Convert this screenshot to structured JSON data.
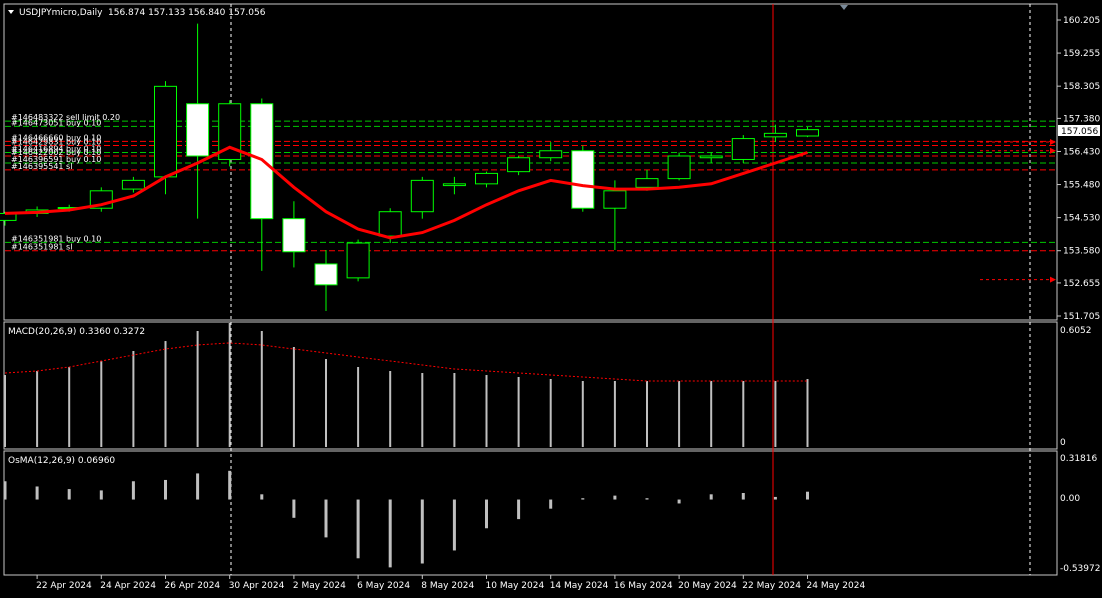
{
  "title": "USDJPYmicro,Daily",
  "ohlc_text": "156.874 157.133 156.840 157.056",
  "colors": {
    "background": "#000000",
    "bull_candle": "#00ff00",
    "bear_candle_body": "#ffffff",
    "ma_line": "#ff0000",
    "order_buy": "#00c800",
    "order_sl": "#ff0000",
    "grid_text": "#ffffff",
    "current_price_box": "#ffffff"
  },
  "main_panel": {
    "price_ticks": [
      "160.205",
      "159.255",
      "158.305",
      "157.380",
      "156.430",
      "155.480",
      "154.530",
      "153.580",
      "152.655",
      "151.705"
    ],
    "price_values": [
      160.205,
      159.255,
      158.305,
      157.38,
      156.43,
      155.48,
      154.53,
      153.58,
      152.655,
      151.705
    ],
    "current_price": "157.056",
    "current_price_value": 157.056,
    "order_labels": [
      {
        "text": "#146483322 sell limit 0.20",
        "price": 157.3,
        "kind": "buy"
      },
      {
        "text": "#146473051 buy 0.10",
        "price": 157.15,
        "kind": "buy"
      },
      {
        "text": "#146466660 buy 0.10",
        "price": 156.72,
        "kind": "sl"
      },
      {
        "text": "#146429831 buy 0.10",
        "price": 156.6,
        "kind": "sl"
      },
      {
        "text": "#146416894 buy 0.10",
        "price": 156.4,
        "kind": "buy"
      },
      {
        "text": "#146422002 buy 0.10",
        "price": 156.3,
        "kind": "sl"
      },
      {
        "text": "#146396591 buy 0.10",
        "price": 156.1,
        "kind": "buy"
      },
      {
        "text": "#146395541 sl",
        "price": 155.9,
        "kind": "sl"
      },
      {
        "text": "#146351981 buy 0.10",
        "price": 153.82,
        "kind": "buy"
      },
      {
        "text": "#146351981 sl",
        "price": 153.58,
        "kind": "sl"
      }
    ]
  },
  "macd_panel": {
    "label": "MACD(20,26,9) 0.3360 0.3272",
    "top_tick": "0.6052",
    "bottom_tick": "0"
  },
  "osma_panel": {
    "label": "OsMA(12,26,9) 0.06960",
    "ticks": [
      "0.31816",
      "0.00",
      "-0.53972"
    ]
  },
  "x_labels": [
    "22 Apr 2024",
    "24 Apr 2024",
    "26 Apr 2024",
    "30 Apr 2024",
    "2 May 2024",
    "6 May 2024",
    "8 May 2024",
    "10 May 2024",
    "14 May 2024",
    "16 May 2024",
    "20 May 2024",
    "22 May 2024",
    "24 May 2024"
  ],
  "chart_data": {
    "type": "candlestick",
    "symbol": "USDJPYmicro",
    "timeframe": "Daily",
    "ylim": [
      151.705,
      160.205
    ],
    "candles": [
      {
        "date": "19 Apr 2024",
        "o": 154.45,
        "h": 154.7,
        "l": 154.3,
        "c": 154.65
      },
      {
        "date": "22 Apr 2024",
        "o": 154.65,
        "h": 154.85,
        "l": 154.55,
        "c": 154.75
      },
      {
        "date": "23 Apr 2024",
        "o": 154.8,
        "h": 154.9,
        "l": 154.7,
        "c": 154.82
      },
      {
        "date": "24 Apr 2024",
        "o": 154.8,
        "h": 155.4,
        "l": 154.7,
        "c": 155.3
      },
      {
        "date": "25 Apr 2024",
        "o": 155.35,
        "h": 155.7,
        "l": 155.25,
        "c": 155.6
      },
      {
        "date": "26 Apr 2024",
        "o": 155.7,
        "h": 158.45,
        "l": 155.2,
        "c": 158.3
      },
      {
        "date": "29 Apr 2024",
        "o": 157.8,
        "h": 160.1,
        "l": 154.5,
        "c": 156.3
      },
      {
        "date": "30 Apr 2024",
        "o": 156.2,
        "h": 157.9,
        "l": 156.0,
        "c": 157.8
      },
      {
        "date": "1 May 2024",
        "o": 157.8,
        "h": 157.95,
        "l": 153.0,
        "c": 154.5
      },
      {
        "date": "2 May 2024",
        "o": 154.5,
        "h": 155.0,
        "l": 153.1,
        "c": 153.55
      },
      {
        "date": "3 May 2024",
        "o": 153.2,
        "h": 153.6,
        "l": 151.85,
        "c": 152.6
      },
      {
        "date": "6 May 2024",
        "o": 152.8,
        "h": 153.9,
        "l": 152.7,
        "c": 153.8
      },
      {
        "date": "7 May 2024",
        "o": 154.0,
        "h": 154.8,
        "l": 153.8,
        "c": 154.7
      },
      {
        "date": "8 May 2024",
        "o": 154.7,
        "h": 155.7,
        "l": 154.5,
        "c": 155.6
      },
      {
        "date": "9 May 2024",
        "o": 155.45,
        "h": 155.7,
        "l": 155.2,
        "c": 155.5
      },
      {
        "date": "10 May 2024",
        "o": 155.5,
        "h": 155.85,
        "l": 155.4,
        "c": 155.8
      },
      {
        "date": "13 May 2024",
        "o": 155.85,
        "h": 156.3,
        "l": 155.75,
        "c": 156.25
      },
      {
        "date": "14 May 2024",
        "o": 156.25,
        "h": 156.7,
        "l": 156.15,
        "c": 156.45
      },
      {
        "date": "15 May 2024",
        "o": 156.45,
        "h": 156.6,
        "l": 154.7,
        "c": 154.8
      },
      {
        "date": "16 May 2024",
        "o": 154.8,
        "h": 155.6,
        "l": 153.6,
        "c": 155.3
      },
      {
        "date": "17 May 2024",
        "o": 155.4,
        "h": 155.9,
        "l": 155.3,
        "c": 155.65
      },
      {
        "date": "20 May 2024",
        "o": 155.65,
        "h": 156.4,
        "l": 155.6,
        "c": 156.3
      },
      {
        "date": "21 May 2024",
        "o": 156.25,
        "h": 156.4,
        "l": 156.1,
        "c": 156.3
      },
      {
        "date": "22 May 2024",
        "o": 156.2,
        "h": 156.9,
        "l": 156.1,
        "c": 156.8
      },
      {
        "date": "23 May 2024",
        "o": 156.85,
        "h": 157.2,
        "l": 156.7,
        "c": 156.95
      },
      {
        "date": "24 May 2024",
        "o": 156.874,
        "h": 157.133,
        "l": 156.84,
        "c": 157.056
      }
    ],
    "ma": [
      154.65,
      154.68,
      154.75,
      154.9,
      155.15,
      155.7,
      156.1,
      156.55,
      156.2,
      155.4,
      154.7,
      154.2,
      153.95,
      154.1,
      154.45,
      154.9,
      155.3,
      155.6,
      155.45,
      155.35,
      155.35,
      155.4,
      155.5,
      155.8,
      156.1,
      156.4
    ],
    "macd": {
      "histogram": [
        0.36,
        0.38,
        0.4,
        0.43,
        0.48,
        0.53,
        0.58,
        0.62,
        0.58,
        0.5,
        0.44,
        0.4,
        0.38,
        0.37,
        0.37,
        0.36,
        0.35,
        0.34,
        0.33,
        0.33,
        0.33,
        0.33,
        0.33,
        0.33,
        0.33,
        0.34
      ],
      "signal": [
        0.37,
        0.38,
        0.4,
        0.43,
        0.46,
        0.49,
        0.51,
        0.52,
        0.51,
        0.49,
        0.47,
        0.45,
        0.43,
        0.41,
        0.39,
        0.38,
        0.37,
        0.36,
        0.35,
        0.34,
        0.33,
        0.33,
        0.33,
        0.33,
        0.33,
        0.33
      ],
      "ylim": [
        0,
        0.6052
      ]
    },
    "osma": {
      "values": [
        0.14,
        0.1,
        0.08,
        0.07,
        0.14,
        0.15,
        0.2,
        0.22,
        0.04,
        -0.14,
        -0.29,
        -0.45,
        -0.52,
        -0.49,
        -0.39,
        -0.22,
        -0.15,
        -0.07,
        0.01,
        0.03,
        0.01,
        -0.03,
        0.04,
        0.05,
        0.02,
        0.06
      ],
      "ylim": [
        -0.53972,
        0.31816
      ]
    }
  }
}
